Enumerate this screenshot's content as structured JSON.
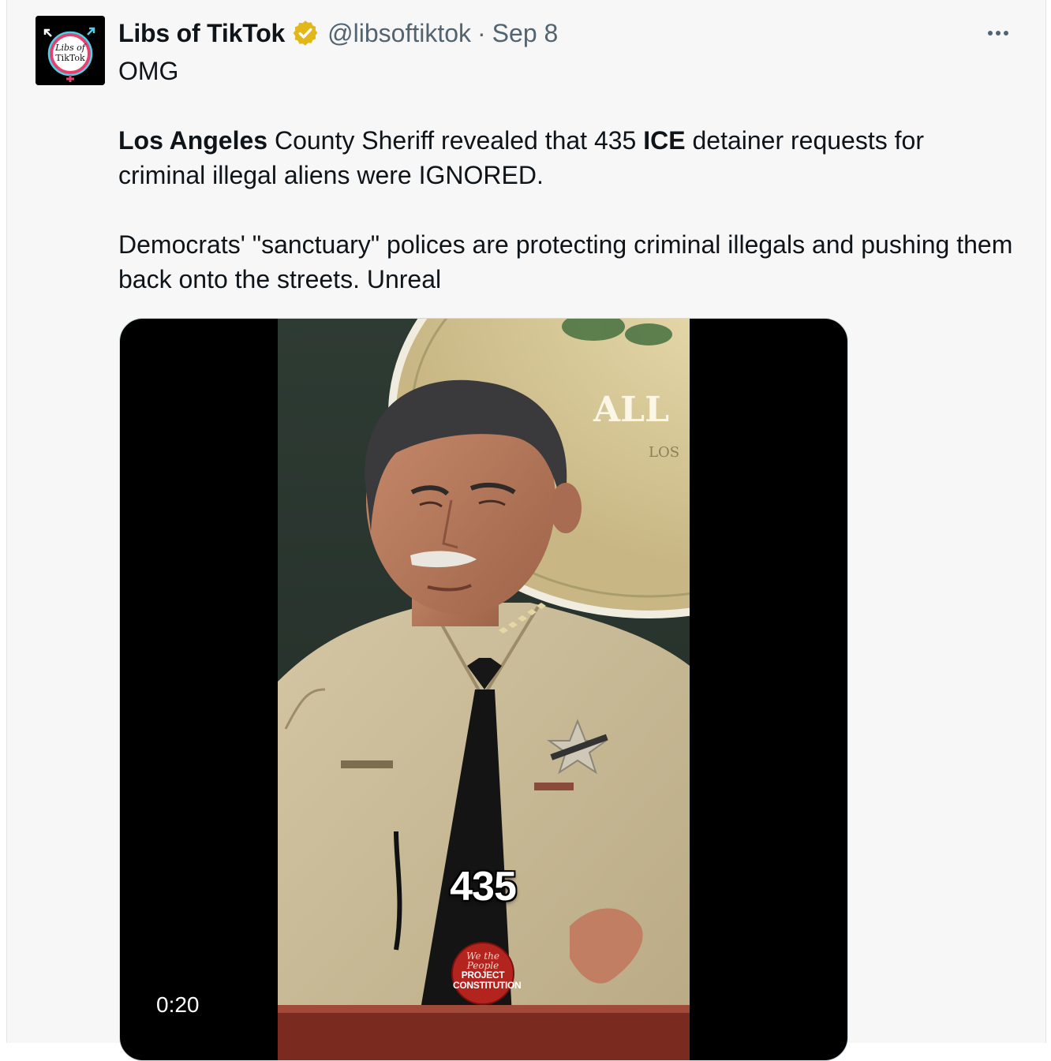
{
  "tweet": {
    "author": {
      "name": "Libs of TikTok",
      "handle": "@libsoftiktok",
      "separator": "·",
      "date": "Sep 8",
      "avatar_text_line1": "Libs of",
      "avatar_text_line2": "TikTok",
      "verified": true,
      "verified_color": "#e2b719"
    },
    "more_icon": "more-horizontal-icon",
    "text": {
      "line1": "OMG",
      "para2_part1_bold": "Los Angeles",
      "para2_part2": " County Sheriff revealed that 435 ",
      "para2_part3_bold": "ICE",
      "para2_part4": " detainer requests for criminal illegal aliens were IGNORED.",
      "para3": "Democrats' \"sanctuary\" polices are protecting criminal illegals and pushing them back onto the streets. Unreal"
    },
    "media": {
      "type": "video",
      "duration": "0:20",
      "overlay_number": "435",
      "watermark_top": "We the People",
      "watermark_line1": "PROJECT",
      "watermark_line2": "CONSTITUTION",
      "background_sign_text": "ALL",
      "background_sign_subtext": "LOS"
    }
  },
  "colors": {
    "text_primary": "#0f1419",
    "text_secondary": "#536471",
    "background": "#f7f7f7"
  }
}
